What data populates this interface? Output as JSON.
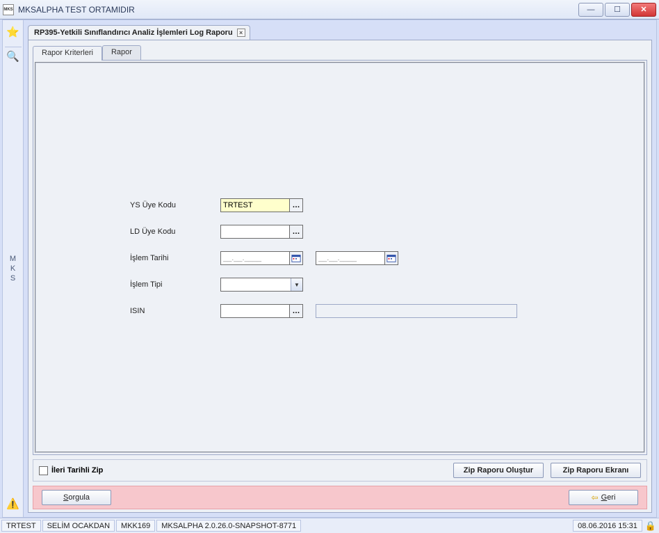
{
  "window": {
    "title": "MKSALPHA TEST ORTAMIDIR",
    "logo_text": "MKS"
  },
  "sidebar": {
    "mks_label": "M\nK\nS"
  },
  "document_tab": {
    "title": "RP395-Yetkili Sınıflandırıcı Analiz İşlemleri Log Raporu"
  },
  "subtabs": {
    "criteria": "Rapor Kriterleri",
    "report": "Rapor"
  },
  "form": {
    "ys_uye_kodu": {
      "label": "YS Üye Kodu",
      "value": "TRTEST"
    },
    "ld_uye_kodu": {
      "label": "LD Üye Kodu",
      "value": ""
    },
    "islem_tarihi": {
      "label": "İşlem Tarihi",
      "from_mask": "__.__.____",
      "to_mask": "__.__.____"
    },
    "islem_tipi": {
      "label": "İşlem Tipi",
      "value": ""
    },
    "isin": {
      "label": "ISIN",
      "value": "",
      "display": ""
    }
  },
  "zip_row": {
    "checkbox_label": "İleri Tarihli Zip",
    "create": "Zip Raporu Oluştur",
    "screen": "Zip Raporu Ekranı"
  },
  "action_row": {
    "query_key": "S",
    "query_rest": "orgula",
    "back_key": "G",
    "back_rest": "eri"
  },
  "status": {
    "user_code": "TRTEST",
    "user_name": "SELİM OCAKDAN",
    "terminal": "MKK169",
    "version": "MKSALPHA 2.0.26.0-SNAPSHOT-8771",
    "datetime": "08.06.2016 15:31"
  }
}
